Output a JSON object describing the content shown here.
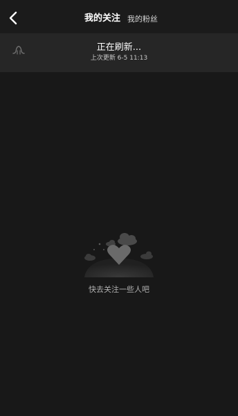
{
  "header": {
    "back_icon": "chevron-left-icon",
    "tabs": [
      {
        "label": "我的关注",
        "active": true
      },
      {
        "label": "我的粉丝",
        "active": false
      }
    ]
  },
  "refresh": {
    "icon": "pull-down-arrow-icon",
    "status": "正在刷新...",
    "last_updated": "上次更新 6-5 11:13"
  },
  "empty_state": {
    "illustration": "heart-clouds-illustration",
    "message": "快去关注一些人吧"
  },
  "colors": {
    "background": "#181818",
    "header_background": "#1b1b1b",
    "refresh_bar_background": "#262626",
    "text_primary": "#ffffff",
    "text_muted": "#b0b0b0"
  }
}
